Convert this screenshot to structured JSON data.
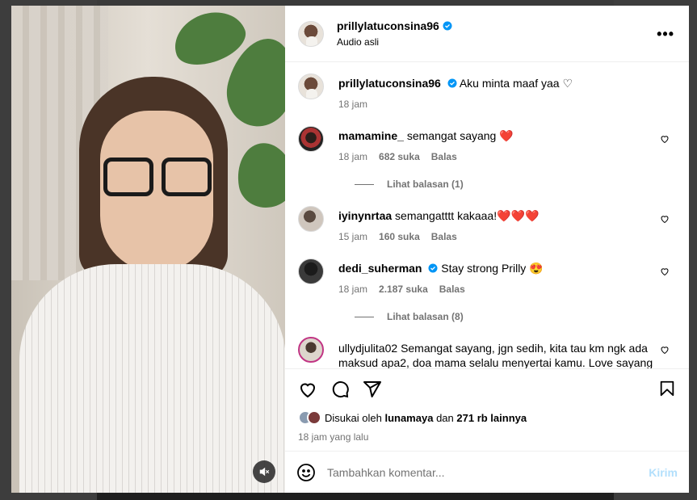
{
  "post": {
    "username": "prillylatuconsina96",
    "audio": "Audio asli",
    "caption": {
      "username": "prillylatuconsina96",
      "text": "Aku minta maaf yaa ♡",
      "time": "18 jam"
    }
  },
  "comments": [
    {
      "username": "mamamine_",
      "text": "semangat sayang ❤️",
      "time": "18 jam",
      "likes": "682 suka",
      "reply": "Balas",
      "view_replies": "Lihat balasan (1)",
      "verified": false
    },
    {
      "username": "iyinynrtaa",
      "text": "semangatttt kakaaa!❤️❤️❤️",
      "time": "15 jam",
      "likes": "160 suka",
      "reply": "Balas",
      "view_replies": "",
      "verified": false
    },
    {
      "username": "dedi_suherman",
      "text": "Stay strong Prilly 😍",
      "time": "18 jam",
      "likes": "2.187 suka",
      "reply": "Balas",
      "view_replies": "Lihat balasan (8)",
      "verified": true
    },
    {
      "username": "ullydjulita02",
      "text": "Semangat sayang, jgn sedih, kita tau km ngk ada maksud apa2, doa mama selalu menyertai kamu. Love sayang",
      "time": "",
      "likes": "",
      "reply": "",
      "view_replies": "",
      "verified": false
    }
  ],
  "likes_line": {
    "prefix": "Disukai oleh",
    "user": "lunamaya",
    "middle": "dan",
    "count": "271 rb lainnya"
  },
  "posted_ago": "18 jam yang lalu",
  "comment_input": {
    "placeholder": "Tambahkan komentar...",
    "send_label": "Kirim"
  },
  "more_label": "•••",
  "colors": {
    "verified": "#0095f6",
    "heart_red": "#ed4956",
    "send_disabled": "#b2dffc"
  },
  "icons": [
    "like-icon",
    "comment-icon",
    "share-icon",
    "save-icon",
    "emoji-icon",
    "mute-icon",
    "more-icon",
    "verified-icon"
  ]
}
